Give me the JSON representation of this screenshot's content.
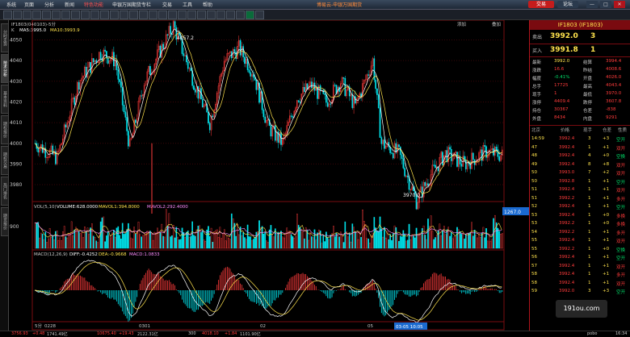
{
  "menu": [
    "系统",
    "页面",
    "分析",
    "新闻",
    "特色功能",
    "申银万国期货专栏",
    "交易",
    "工具",
    "帮助"
  ],
  "window_title": "博易云-申银万国期货",
  "trade_button": "交易",
  "forum_button": "论坛",
  "window_controls": [
    "—",
    "□",
    "✕"
  ],
  "left_tabs": [
    "分时走势",
    "技术分析",
    "基本资料",
    "期权报价",
    "期权交易",
    "热门排名",
    "期货报价"
  ],
  "chart_header": "IF1803(040103)-5分",
  "ma_legend": {
    "k": "K",
    "ma5": "MA5:3995.0",
    "ma10": "MA10:3993.9"
  },
  "top_right_links": {
    "a": "添加",
    "b": "叠加"
  },
  "volume_header": {
    "vol": "VOL(5,10)",
    "volume": "VOLUME:628.0000",
    "mavol1": "MAVOL1:394.8000",
    "mavol2": "MAVOL2:292.4000"
  },
  "macd_header": {
    "macd": "MACD(12,26,9)",
    "diff": "DIFF:-0.4252",
    "dea": "DEA:-0.9668",
    "macdv": "MACD:1.0833"
  },
  "volume_marker": "1267.0",
  "x_axis_labels": [
    "5分",
    "0228",
    "0301",
    "02",
    "05",
    "03-05 10:05"
  ],
  "colors": {
    "up": "#ff3b3b",
    "down": "#00e5ee",
    "ma5": "#ffffff",
    "ma10": "#ffe34d",
    "accent": "#b0141c"
  },
  "chart_data": {
    "type": "candlestick",
    "title": "IF1803(040103)-5分",
    "y_axis_ticks": [
      3980,
      3990,
      4000,
      4010,
      4020,
      4030,
      4040,
      4050
    ],
    "price_annotations": {
      "high": "4057.2",
      "low": "3970.0"
    },
    "volume_axis_tick": 900,
    "ohlc": []
  },
  "quote": {
    "title": "IF1803 (IF1803)",
    "sell_label": "卖出",
    "sell_price": "3992.0",
    "sell_vol": "3",
    "buy_label": "买入",
    "buy_price": "3991.8",
    "buy_vol": "1",
    "stats": [
      {
        "l1": "最新",
        "v1": "3992.0",
        "l2": "结算",
        "v2": "3994.4"
      },
      {
        "l1": "涨跌",
        "v1": "16.6",
        "l2": "昨结",
        "v2": "4008.6"
      },
      {
        "l1": "幅度",
        "v1": "-0.41%",
        "l2": "开盘",
        "v2": "4026.0"
      },
      {
        "l1": "总手",
        "v1": "17725",
        "l2": "最高",
        "v2": "4043.4"
      },
      {
        "l1": "现手",
        "v1": "1",
        "l2": "最低",
        "v2": "3970.0"
      },
      {
        "l1": "涨停",
        "v1": "4409.4",
        "l2": "跌停",
        "v2": "3607.8"
      },
      {
        "l1": "持仓",
        "v1": "30367",
        "l2": "仓差",
        "v2": "-838"
      },
      {
        "l1": "外盘",
        "v1": "8434",
        "l2": "内盘",
        "v2": "9291"
      }
    ],
    "ticks_header": [
      "北京",
      "价格",
      "现手",
      "仓差",
      "性质"
    ],
    "ticks": [
      {
        "t": "14:59",
        "p": "3992.4",
        "v": "3",
        "d": "+3",
        "k": "空开"
      },
      {
        "t": "47",
        "p": "3992.4",
        "v": "1",
        "d": "+1",
        "k": "双开"
      },
      {
        "t": "48",
        "p": "3992.4",
        "v": "4",
        "d": "+0",
        "k": "空换"
      },
      {
        "t": "49",
        "p": "3992.4",
        "v": "8",
        "d": "+8",
        "k": "双开"
      },
      {
        "t": "50",
        "p": "3993.0",
        "v": "7",
        "d": "+2",
        "k": "双开"
      },
      {
        "t": "50",
        "p": "3992.8",
        "v": "1",
        "d": "+1",
        "k": "空开"
      },
      {
        "t": "51",
        "p": "3992.4",
        "v": "1",
        "d": "+1",
        "k": "双开"
      },
      {
        "t": "51",
        "p": "3992.2",
        "v": "1",
        "d": "+1",
        "k": "多开"
      },
      {
        "t": "52",
        "p": "3992.4",
        "v": "1",
        "d": "+1",
        "k": "空开"
      },
      {
        "t": "53",
        "p": "3992.4",
        "v": "1",
        "d": "+0",
        "k": "多换"
      },
      {
        "t": "53",
        "p": "3992.2",
        "v": "1",
        "d": "+0",
        "k": "多换"
      },
      {
        "t": "54",
        "p": "3992.2",
        "v": "1",
        "d": "+1",
        "k": "多开"
      },
      {
        "t": "55",
        "p": "3992.4",
        "v": "1",
        "d": "+1",
        "k": "双开"
      },
      {
        "t": "55",
        "p": "3992.2",
        "v": "1",
        "d": "+0",
        "k": "空换"
      },
      {
        "t": "56",
        "p": "3992.4",
        "v": "1",
        "d": "+1",
        "k": "空开"
      },
      {
        "t": "57",
        "p": "3992.4",
        "v": "1",
        "d": "+1",
        "k": "双开"
      },
      {
        "t": "58",
        "p": "3992.4",
        "v": "1",
        "d": "+1",
        "k": "多开"
      },
      {
        "t": "58",
        "p": "3992.4",
        "v": "1",
        "d": "+1",
        "k": "双开"
      },
      {
        "t": "59",
        "p": "3992.0",
        "v": "3",
        "d": "+3",
        "k": "空开"
      }
    ]
  },
  "status": {
    "a": "3756.93",
    "b": "+0.48",
    "c": "1741.49亿",
    "d": "10675.40",
    "e": "+19.43",
    "f": "2122.31亿",
    "g": "300",
    "h": "4018.10",
    "i": "+1.84",
    "j": "1101.90亿",
    "k": "pobo",
    "l": "16:34"
  },
  "watermark": "191ou.com"
}
